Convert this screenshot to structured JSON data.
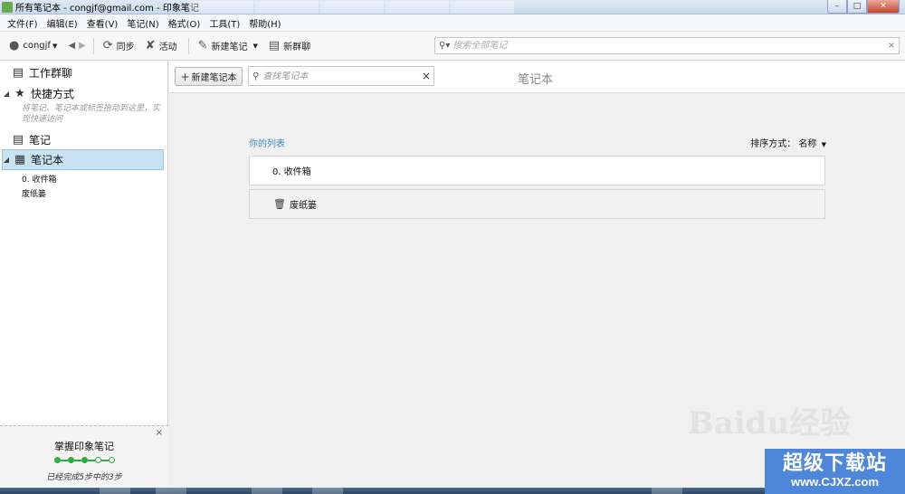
{
  "window": {
    "title": "所有笔记本 - congjf@gmail.com - 印象笔记",
    "min_label": "–",
    "max_label": "□",
    "close_label": "✕"
  },
  "menu": [
    {
      "label": "文件(F)"
    },
    {
      "label": "编辑(E)"
    },
    {
      "label": "查看(V)"
    },
    {
      "label": "笔记(N)"
    },
    {
      "label": "格式(O)"
    },
    {
      "label": "工具(T)"
    },
    {
      "label": "帮助(H)"
    }
  ],
  "toolbar": {
    "user_label": "congjf",
    "sync_label": "同步",
    "activity_label": "活动",
    "new_note_label": "新建笔记",
    "new_group_chat_label": "新群聊",
    "search_placeholder": "搜索全部笔记",
    "clear_label": "×"
  },
  "sidebar": {
    "work_chat": "工作群聊",
    "shortcuts": "快捷方式",
    "shortcuts_hint": "将笔记、笔记本或标签拖动到这里，实现快速访问",
    "notes": "笔记",
    "notebooks": "笔记本",
    "sub_items": [
      "0. 收件箱",
      "废纸篓"
    ],
    "promo": {
      "close_label": "×",
      "title": "掌握印象笔记",
      "steps_total": 5,
      "steps_done": 3,
      "subtitle": "已经完成5步中的3步"
    }
  },
  "main": {
    "new_notebook_label": "新建笔记本",
    "search_placeholder": "查找笔记本",
    "clear_label": "×",
    "title": "笔记本",
    "list_caption": "你的列表",
    "sort_label": "排序方式：  名称",
    "rows": [
      "0. 收件箱",
      "废纸篓"
    ]
  },
  "watermark": {
    "baidu": "Baidu经验",
    "site_cn": "超级下载站",
    "site_url": "www.CJXZ.com"
  },
  "colors": {
    "selection": "#c9e2f3",
    "link_blue": "#3a8bcf",
    "progress_green": "#2eac3c",
    "watermark_blue": "#4e86d9"
  }
}
